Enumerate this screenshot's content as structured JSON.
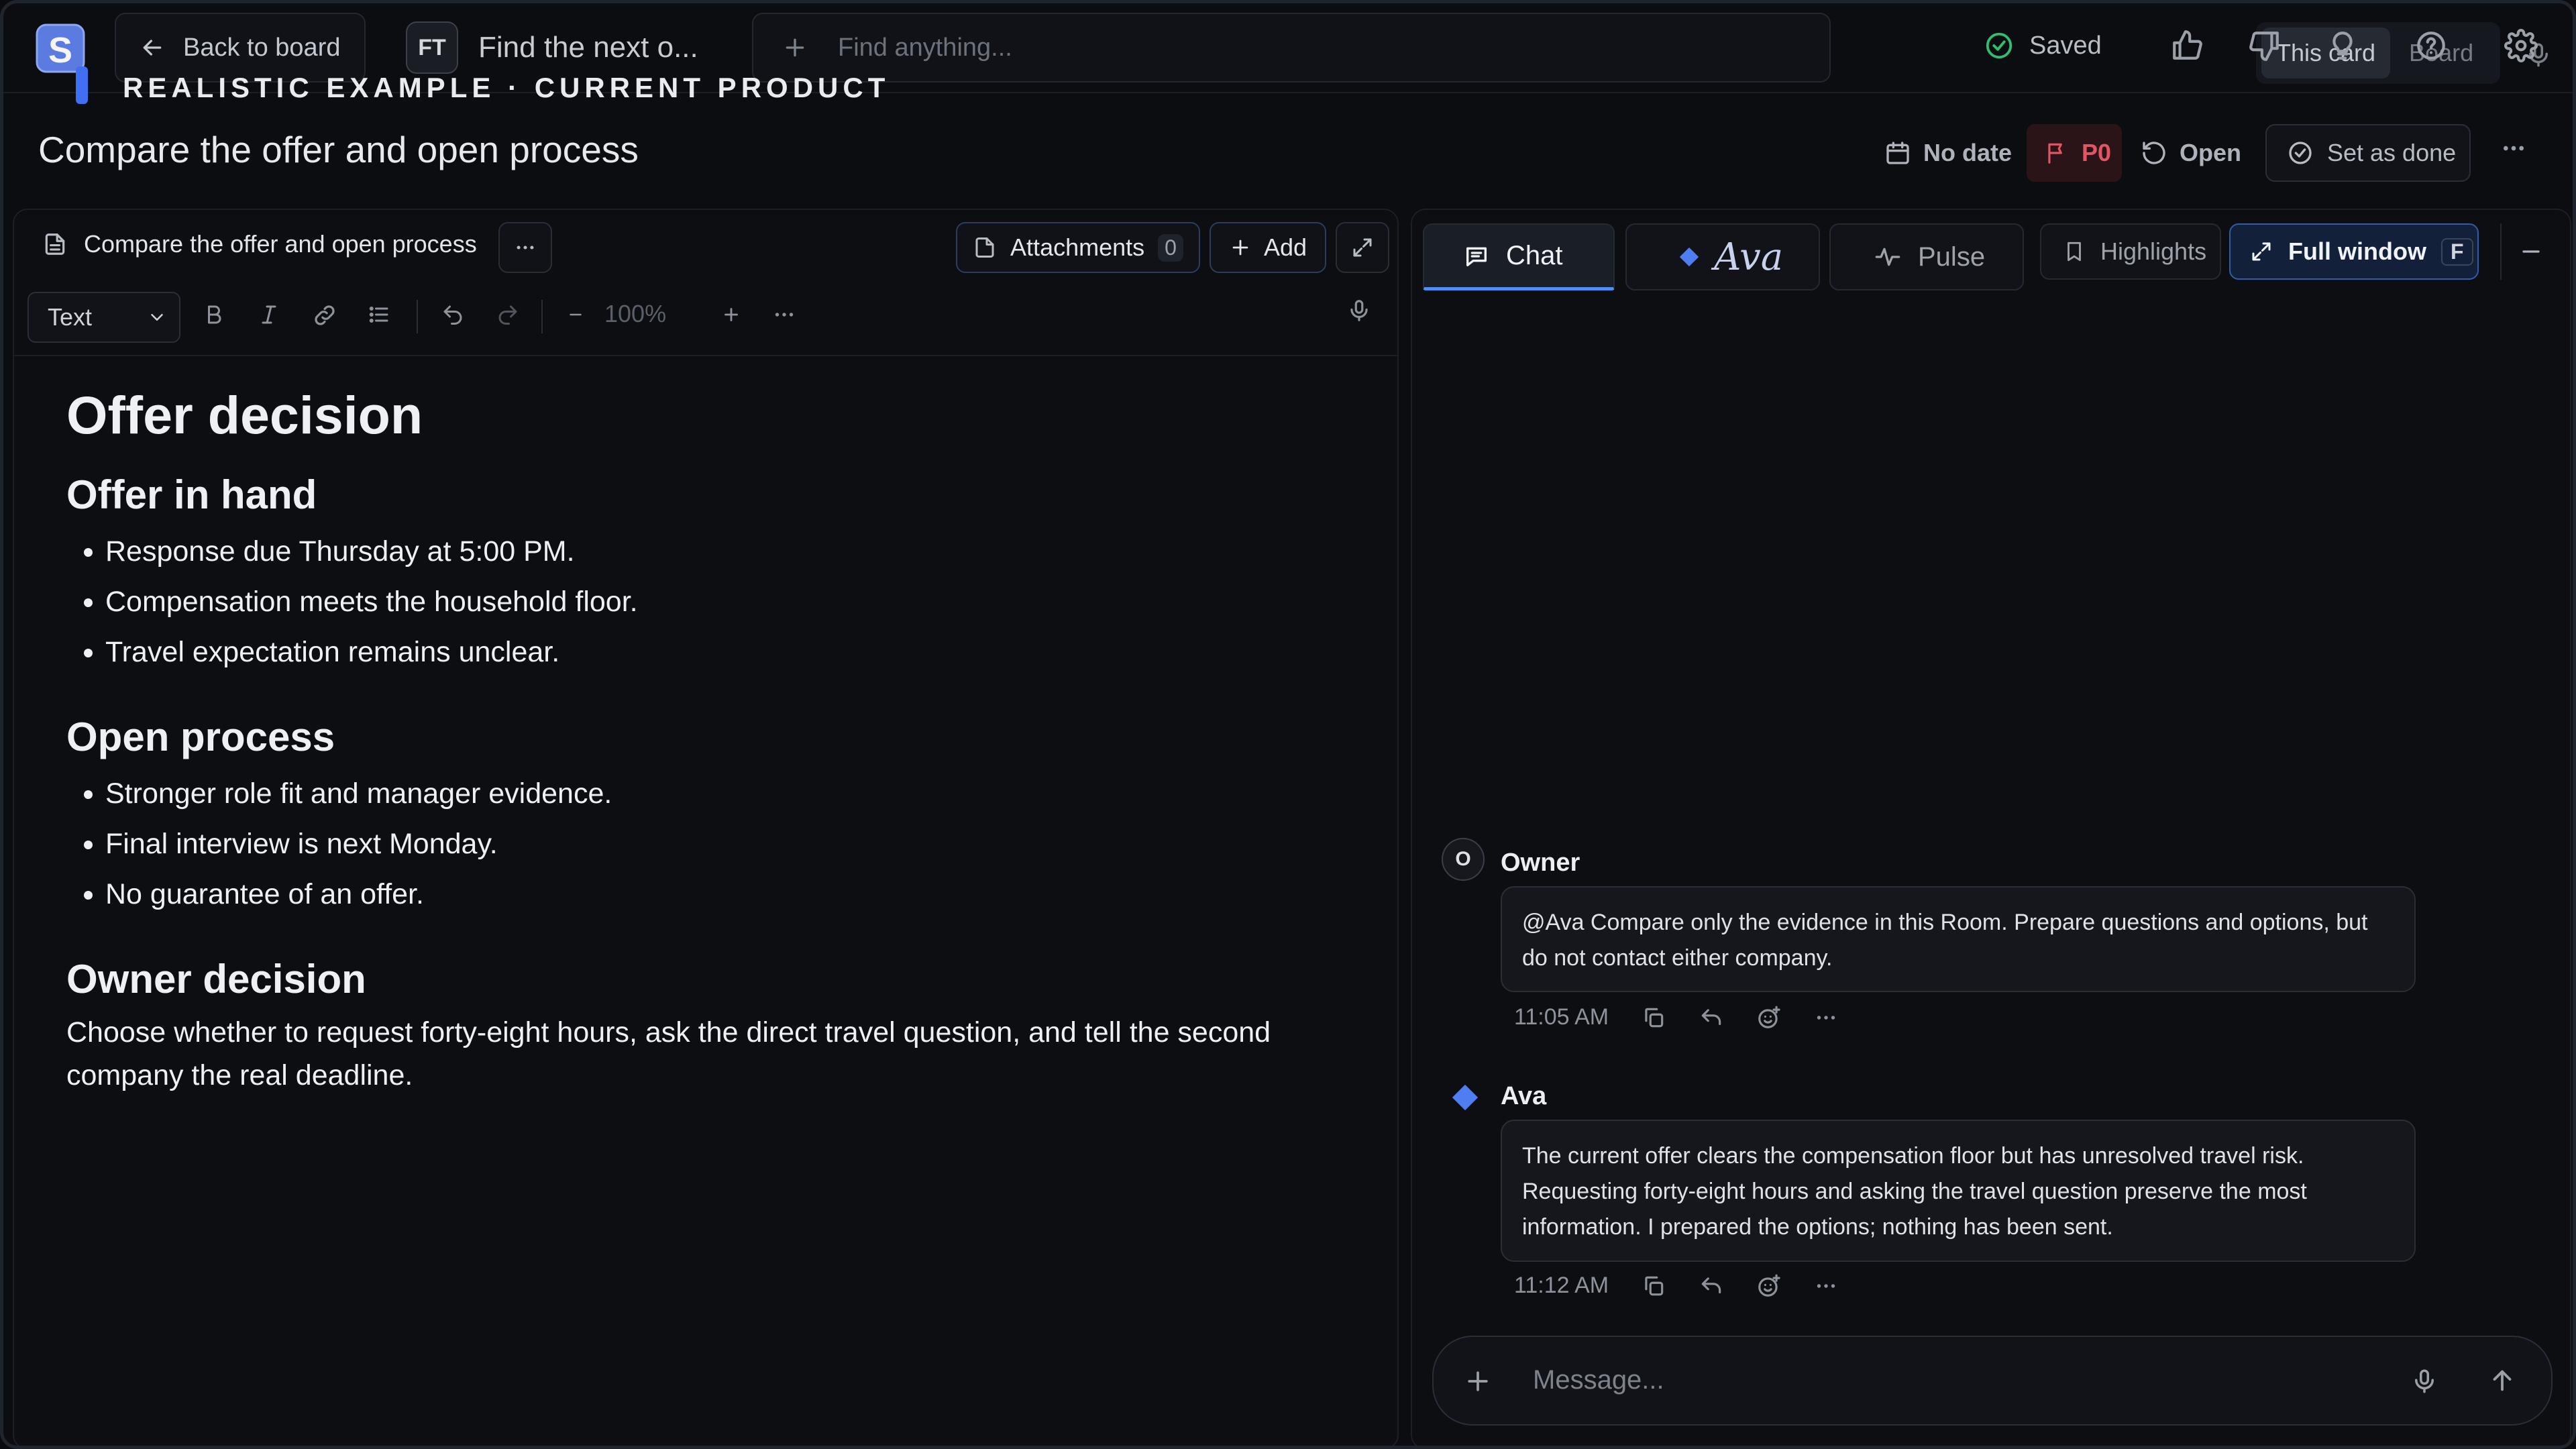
{
  "topbar": {
    "logo_letter": "S",
    "back_label": "Back to board",
    "card_initials": "FT",
    "card_name": "Find the next o...",
    "search_placeholder": "Find anything...",
    "scope_options": [
      "This card",
      "Board"
    ],
    "scope_selected": "This card",
    "saved_label": "Saved"
  },
  "banner": "REALISTIC EXAMPLE · CURRENT PRODUCT",
  "header": {
    "title": "Compare the offer and open process",
    "date_label": "No date",
    "priority_label": "P0",
    "status_label": "Open",
    "done_label": "Set as done"
  },
  "editor": {
    "doc_name": "Compare the offer and open process",
    "attachments_label": "Attachments",
    "attachments_count": "0",
    "add_label": "Add",
    "text_style": "Text",
    "zoom": "100%",
    "heading": "Offer decision",
    "sections": [
      {
        "title": "Offer in hand",
        "items": [
          "Response due Thursday at 5:00 PM.",
          "Compensation meets the household floor.",
          "Travel expectation remains unclear."
        ]
      },
      {
        "title": "Open process",
        "items": [
          "Stronger role fit and manager evidence.",
          "Final interview is next Monday.",
          "No guarantee of an offer."
        ]
      },
      {
        "title": "Owner decision",
        "paragraph": "Choose whether to request forty-eight hours, ask the direct travel question, and tell the second company the real deadline."
      }
    ]
  },
  "chat": {
    "tabs": [
      "Chat",
      "Ava",
      "Pulse"
    ],
    "highlights_label": "Highlights",
    "full_window_label": "Full window",
    "full_window_key": "F",
    "messages": [
      {
        "author": "Owner",
        "initial": "O",
        "text": "@Ava Compare only the evidence in this Room. Prepare questions and options, but do not contact either company.",
        "time": "11:05 AM"
      },
      {
        "author": "Ava",
        "text": "The current offer clears the compensation floor but has unresolved travel risk. Requesting forty-eight hours and asking the travel question preserve the most information. I prepared the options; nothing has been sent.",
        "time": "11:12 AM"
      }
    ],
    "composer_placeholder": "Message..."
  },
  "colors": {
    "accent": "#4f8df5",
    "priority": "#e25563",
    "saved": "#2fbf71",
    "background": "#0c0d11"
  }
}
